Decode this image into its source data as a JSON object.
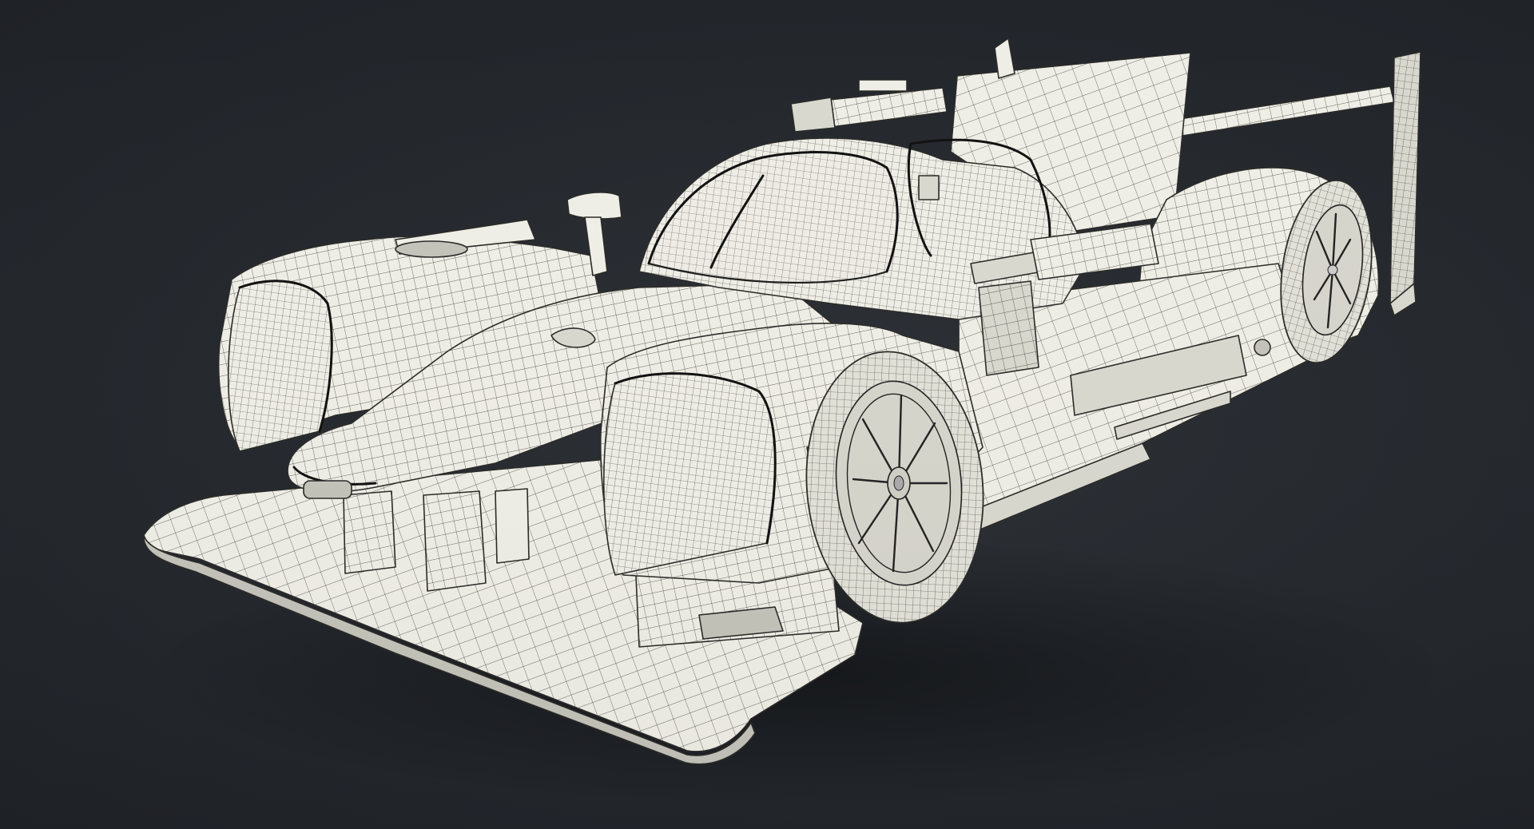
{
  "scene": {
    "subject": "",
    "background_color": "#25292e",
    "model_fill_color": "#efeee6",
    "wire_color": "#2a2a28"
  }
}
